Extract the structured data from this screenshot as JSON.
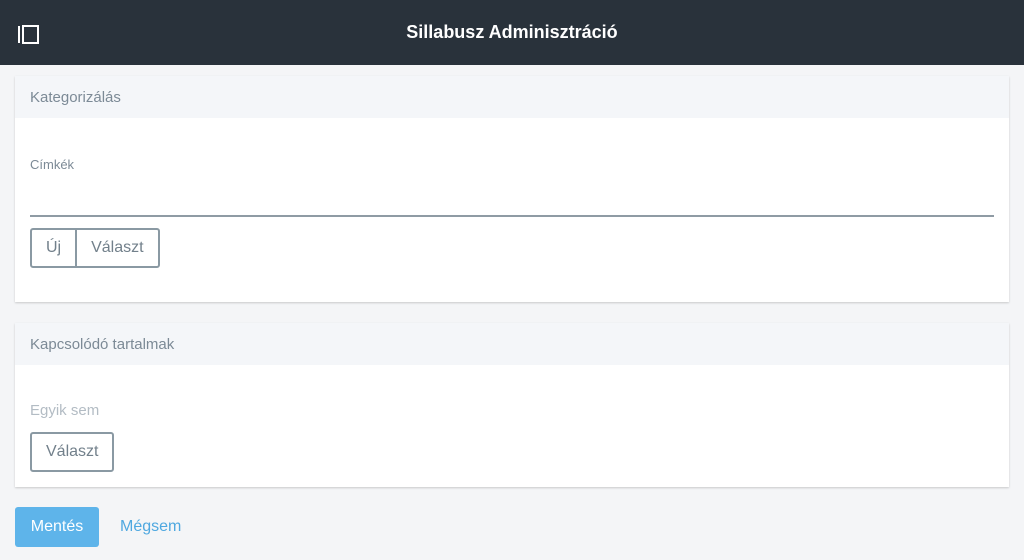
{
  "header": {
    "title": "Sillabusz Adminisztráció",
    "toggle_icon": "sidebar-toggle-icon",
    "background": "#29323b"
  },
  "categorization": {
    "heading": "Kategorizálás",
    "tags_label": "Címkék",
    "tags_value": "",
    "new_label": "Új",
    "choose_label": "Választ"
  },
  "related": {
    "heading": "Kapcsolódó tartalmak",
    "empty_text": "Egyik sem",
    "choose_label": "Választ"
  },
  "footer": {
    "save_label": "Mentés",
    "cancel_label": "Mégsem",
    "accent": "#5eb4ea"
  }
}
